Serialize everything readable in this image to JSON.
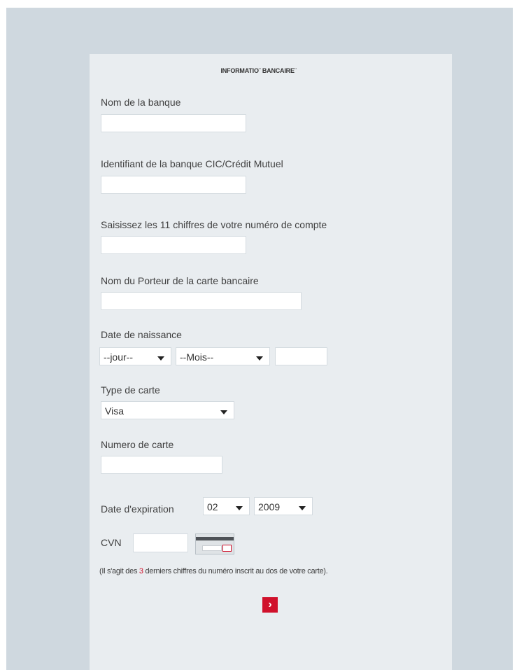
{
  "form": {
    "title": "INFORMATIO¨ BANCAIRE¨",
    "bank_name": {
      "label": "Nom de la banque",
      "value": ""
    },
    "bank_id": {
      "label": "Identifiant de la banque CIC/Crédit Mutuel",
      "value": ""
    },
    "account_number": {
      "label": "Saisissez les 11 chiffres de votre numéro de compte",
      "value": ""
    },
    "card_holder": {
      "label": "Nom du Porteur de la carte bancaire",
      "value": ""
    },
    "birth_date": {
      "label": "Date de naissance",
      "day_selected": "--jour--",
      "month_selected": "--Mois--",
      "year_value": ""
    },
    "card_type": {
      "label": "Type de carte",
      "selected": "Visa"
    },
    "card_number": {
      "label": "Numero de carte",
      "value": ""
    },
    "expiration": {
      "label": "Date d'expiration",
      "month_selected": "02",
      "year_selected": "2009"
    },
    "cvn": {
      "label": "CVN",
      "value": "",
      "help_before": "(Il s'agit des ",
      "help_highlight": "3",
      "help_after": " derniers chiffres du numéro inscrit au dos de votre carte)."
    },
    "submit_glyph": "›"
  },
  "colors": {
    "page_background": "#cfd8df",
    "panel_background": "#e9edf0",
    "accent_red": "#d0112b"
  },
  "icons": [
    "chevron-down-icon",
    "card-back-cvv-icon",
    "chevron-right-icon"
  ]
}
